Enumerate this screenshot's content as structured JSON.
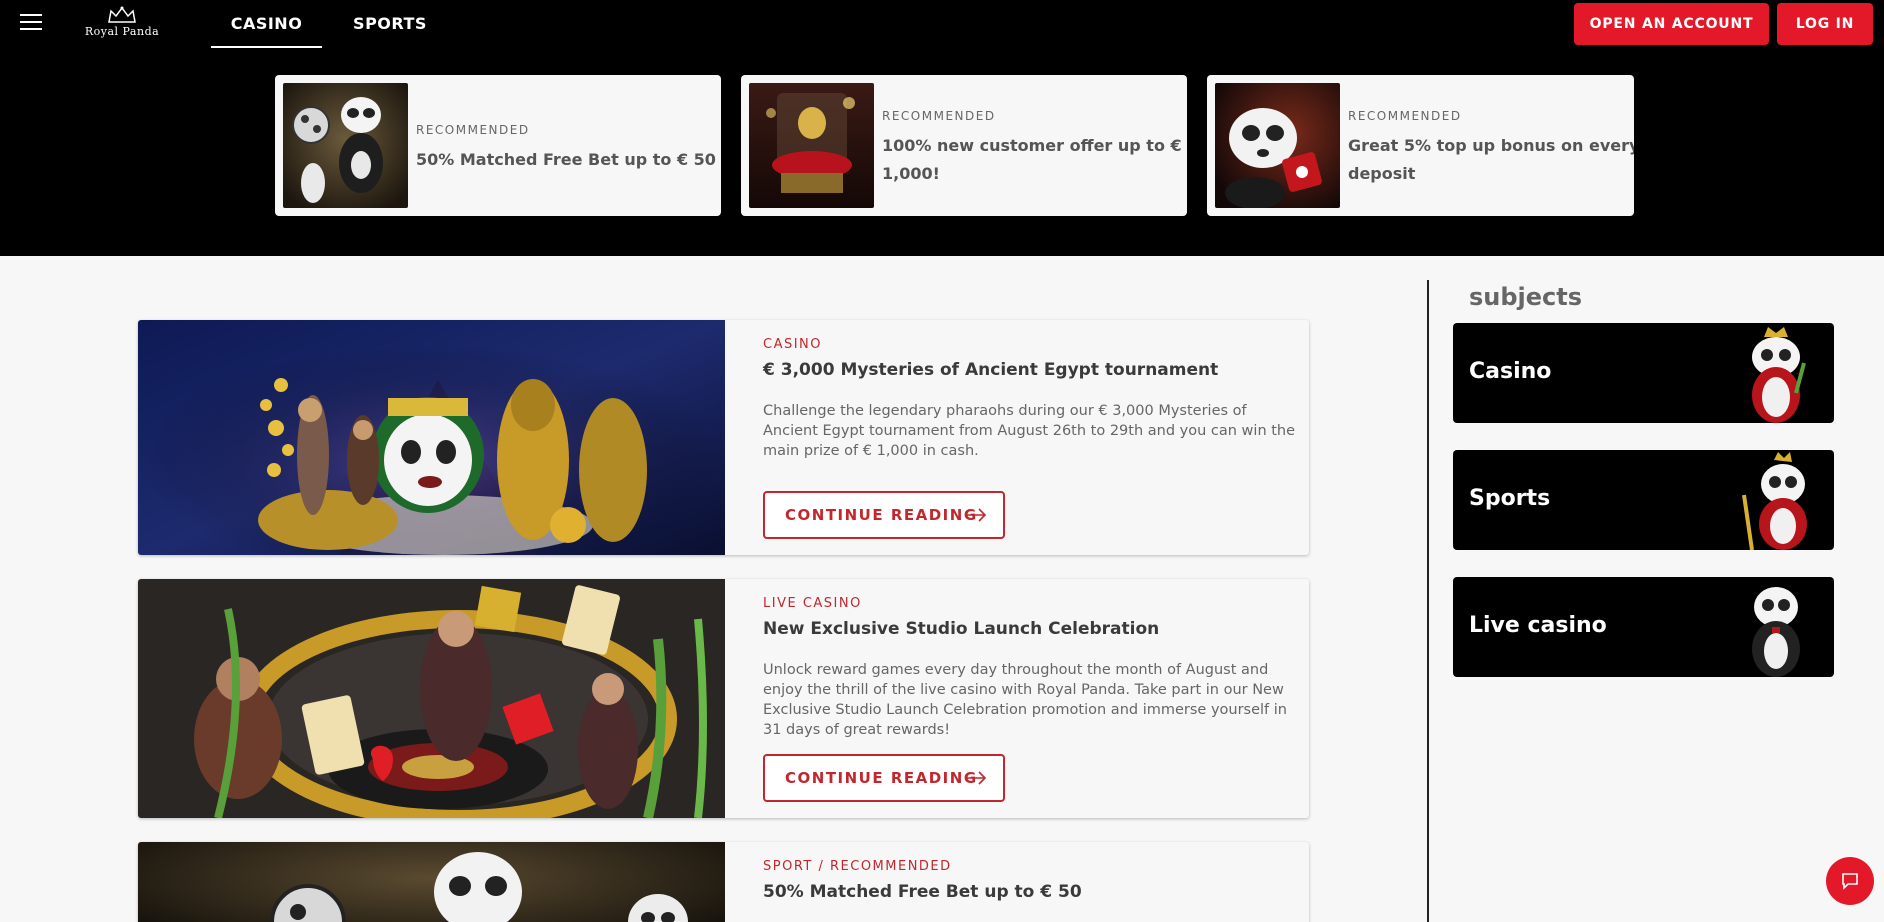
{
  "nav": {
    "logo_text": "Royal Panda",
    "tabs": [
      {
        "label": "CASINO",
        "active": true
      },
      {
        "label": "SPORTS",
        "active": false
      }
    ],
    "open_account_label": "OPEN AN ACCOUNT",
    "login_label": "LOG IN"
  },
  "promos": [
    {
      "tag": "RECOMMENDED",
      "title": "50% Matched Free Bet up to € 50"
    },
    {
      "tag": "RECOMMENDED",
      "title": "100% new customer offer up to € 1,000!"
    },
    {
      "tag": "RECOMMENDED",
      "title": "Great 5% top up bonus on every deposit"
    }
  ],
  "articles": [
    {
      "tag": "CASINO",
      "title": "€ 3,000 Mysteries of Ancient Egypt tournament",
      "description": "Challenge the legendary pharaohs during our € 3,000 Mysteries of Ancient Egypt tournament from August 26th to 29th and you can win the main prize of € 1,000 in cash.",
      "button": "CONTINUE READING"
    },
    {
      "tag": "LIVE CASINO",
      "title": "New Exclusive Studio Launch Celebration",
      "description": "Unlock reward games every day throughout the month of August and enjoy the thrill of the live casino with Royal Panda. Take part in our New Exclusive Studio Launch Celebration promotion and immerse yourself in 31 days of great rewards!",
      "button": "CONTINUE READING"
    },
    {
      "tag": "SPORT / RECOMMENDED",
      "title": "50% Matched Free Bet up to € 50"
    }
  ],
  "sidebar": {
    "title": "subjects",
    "items": [
      {
        "label": "Casino"
      },
      {
        "label": "Sports"
      },
      {
        "label": "Live casino"
      }
    ]
  },
  "colors": {
    "brand_red": "#e3192a",
    "accent_red": "#c1272d",
    "header_bg": "#000000"
  }
}
